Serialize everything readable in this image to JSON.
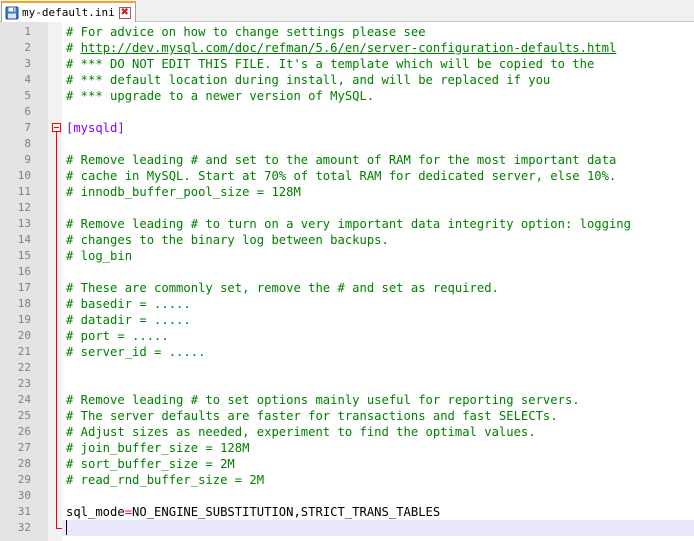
{
  "tab": {
    "title": "my-default.ini",
    "close_glyph": "✖",
    "icon": "save-icon",
    "accent": "#f5a623"
  },
  "colors": {
    "comment": "#008000",
    "section": "#8000ff",
    "operator": "#ff0000",
    "gutter": "#e4e4e4",
    "current_line": "#e8e8ff"
  },
  "current_line": 32,
  "lines": [
    {
      "n": "1",
      "type": "comment",
      "text": "# For advice on how to change settings please see"
    },
    {
      "n": "2",
      "type": "link",
      "prefix": "# ",
      "url": "http://dev.mysql.com/doc/refman/5.6/en/server-configuration-defaults.html"
    },
    {
      "n": "3",
      "type": "comment",
      "text": "# *** DO NOT EDIT THIS FILE. It's a template which will be copied to the"
    },
    {
      "n": "4",
      "type": "comment",
      "text": "# *** default location during install, and will be replaced if you"
    },
    {
      "n": "5",
      "type": "comment",
      "text": "# *** upgrade to a newer version of MySQL."
    },
    {
      "n": "6",
      "type": "blank",
      "text": ""
    },
    {
      "n": "7",
      "type": "section",
      "text": "[mysqld]"
    },
    {
      "n": "8",
      "type": "blank",
      "text": ""
    },
    {
      "n": "9",
      "type": "comment",
      "text": "# Remove leading # and set to the amount of RAM for the most important data"
    },
    {
      "n": "10",
      "type": "comment",
      "text": "# cache in MySQL. Start at 70% of total RAM for dedicated server, else 10%."
    },
    {
      "n": "11",
      "type": "comment",
      "text": "# innodb_buffer_pool_size = 128M"
    },
    {
      "n": "12",
      "type": "blank",
      "text": ""
    },
    {
      "n": "13",
      "type": "comment",
      "text": "# Remove leading # to turn on a very important data integrity option: logging"
    },
    {
      "n": "14",
      "type": "comment",
      "text": "# changes to the binary log between backups."
    },
    {
      "n": "15",
      "type": "comment",
      "text": "# log_bin"
    },
    {
      "n": "16",
      "type": "blank",
      "text": ""
    },
    {
      "n": "17",
      "type": "comment",
      "text": "# These are commonly set, remove the # and set as required."
    },
    {
      "n": "18",
      "type": "comment",
      "text": "# basedir = ....."
    },
    {
      "n": "19",
      "type": "comment",
      "text": "# datadir = ....."
    },
    {
      "n": "20",
      "type": "comment",
      "text": "# port = ....."
    },
    {
      "n": "21",
      "type": "comment",
      "text": "# server_id = ....."
    },
    {
      "n": "22",
      "type": "blank",
      "text": ""
    },
    {
      "n": "23",
      "type": "blank",
      "text": ""
    },
    {
      "n": "24",
      "type": "comment",
      "text": "# Remove leading # to set options mainly useful for reporting servers."
    },
    {
      "n": "25",
      "type": "comment",
      "text": "# The server defaults are faster for transactions and fast SELECTs."
    },
    {
      "n": "26",
      "type": "comment",
      "text": "# Adjust sizes as needed, experiment to find the optimal values."
    },
    {
      "n": "27",
      "type": "comment",
      "text": "# join_buffer_size = 128M"
    },
    {
      "n": "28",
      "type": "comment",
      "text": "# sort_buffer_size = 2M"
    },
    {
      "n": "29",
      "type": "comment",
      "text": "# read_rnd_buffer_size = 2M"
    },
    {
      "n": "30",
      "type": "blank",
      "text": ""
    },
    {
      "n": "31",
      "type": "keyvalue",
      "key": "sql_mode",
      "op": "=",
      "value": "NO_ENGINE_SUBSTITUTION,STRICT_TRANS_TABLES"
    },
    {
      "n": "32",
      "type": "blank",
      "text": ""
    }
  ]
}
